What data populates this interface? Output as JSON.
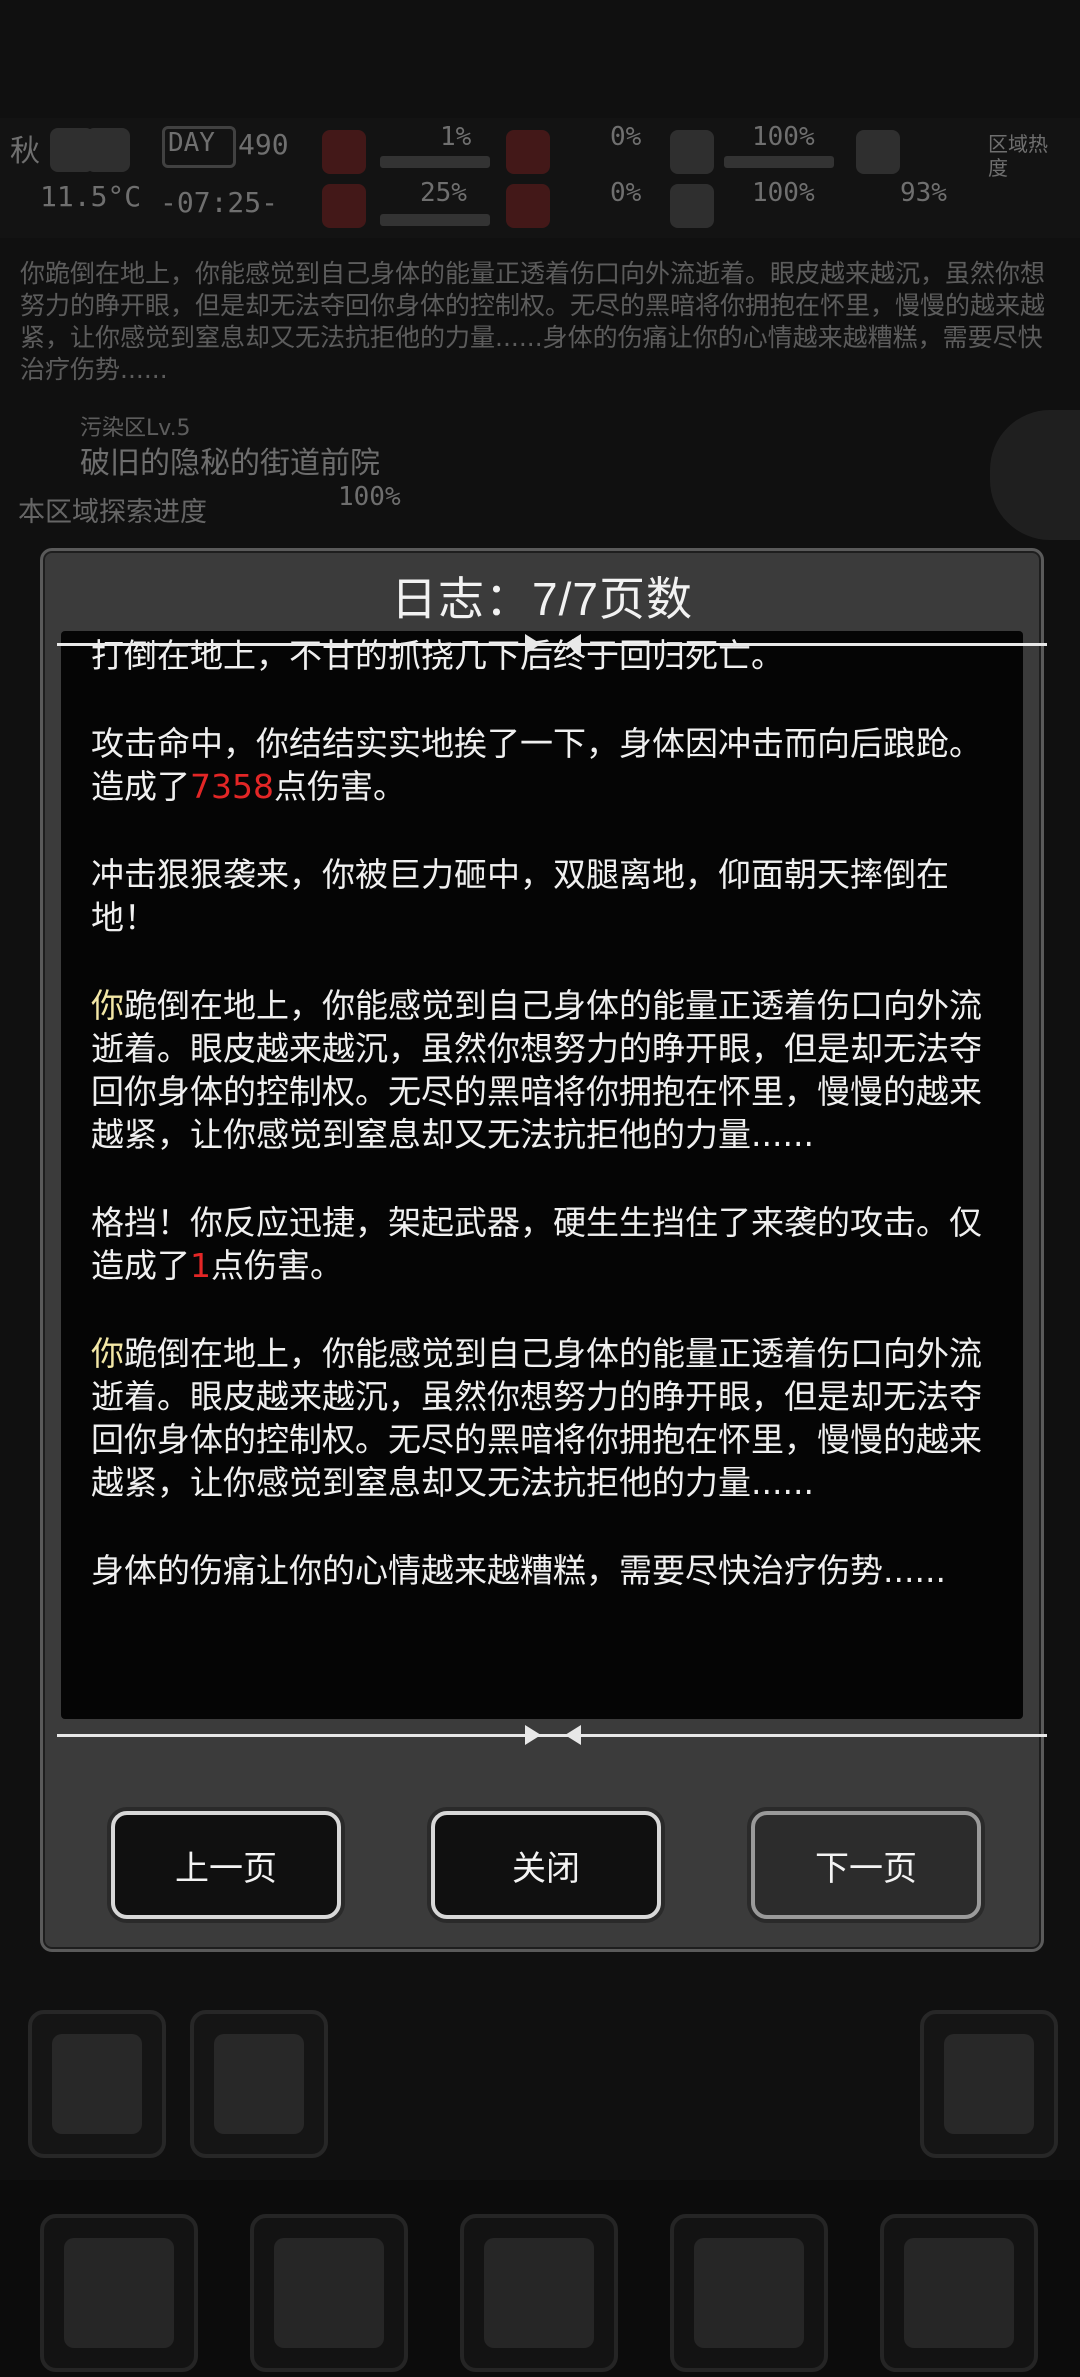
{
  "hud": {
    "season": "秋",
    "day_label": "DAY",
    "day_value": "490",
    "temperature": "11.5°C",
    "clock": "-07:25-",
    "stat_1": "1%",
    "stat_2": "0%",
    "stat_3": "100%",
    "stat_4": "25%",
    "stat_5": "0%",
    "stat_6": "100%",
    "stat_7": "93%",
    "area_heat_label": "区域热度"
  },
  "background_message": "你跪倒在地上，你能感觉到自己身体的能量正透着伤口向外流逝着。眼皮越来越沉，虽然你想努力的睁开眼，但是却无法夺回你身体的控制权。无尽的黑暗将你拥抱在怀里，慢慢的越来越紧，让你感觉到窒息却又无法抗拒他的力量......身体的伤痛让你的心情越来越糟糕，需要尽快治疗伤势......",
  "area": {
    "level": "污染区Lv.5",
    "name": "破旧的隐秘的街道前院",
    "progress_label": "本区域探索进度",
    "progress_value": "100%"
  },
  "dialog": {
    "title": "日志：7/7页数",
    "entries": [
      {
        "text": "你挣扎地仰起身体，但是你已经被打得半死，不能动弹……被打倒在地上，不甘的抓挠几下后终于回归死亡。"
      },
      {
        "before": "攻击命中，你结结实实地挨了一下，身体因冲击而向后踉跄。造成了",
        "damage": "7358",
        "after": "点伤害。"
      },
      {
        "text": "冲击狠狠袭来，你被巨力砸中，双腿离地，仰面朝天摔倒在地！"
      },
      {
        "first": "你",
        "rest": "跪倒在地上，你能感觉到自己身体的能量正透着伤口向外流逝着。眼皮越来越沉，虽然你想努力的睁开眼，但是却无法夺回你身体的控制权。无尽的黑暗将你拥抱在怀里，慢慢的越来越紧，让你感觉到窒息却又无法抗拒他的力量......"
      },
      {
        "before": "格挡！你反应迅捷，架起武器，硬生生挡住了来袭的攻击。仅造成了",
        "damage": "1",
        "after": "点伤害。"
      },
      {
        "first": "你",
        "rest": "跪倒在地上，你能感觉到自己身体的能量正透着伤口向外流逝着。眼皮越来越沉，虽然你想努力的睁开眼，但是却无法夺回你身体的控制权。无尽的黑暗将你拥抱在怀里，慢慢的越来越紧，让你感觉到窒息却又无法抗拒他的力量......"
      },
      {
        "text": "身体的伤痛让你的心情越来越糟糕，需要尽快治疗伤势......"
      }
    ],
    "buttons": {
      "prev": "上一页",
      "close": "关闭",
      "next": "下一页"
    }
  },
  "colors": {
    "damage": "#e32626",
    "dialog_bg": "#3b3b3b",
    "log_bg": "#050505"
  }
}
